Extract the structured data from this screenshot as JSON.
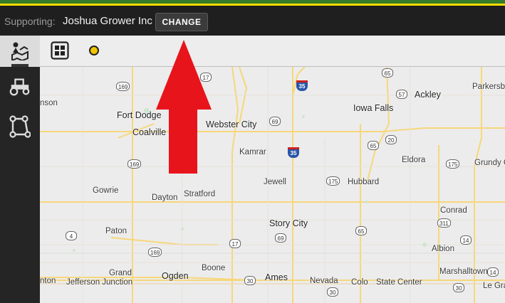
{
  "header": {
    "supporting_label": "Supporting:",
    "organization": "Joshua Grower Inc",
    "change_button": "CHANGE"
  },
  "toolbar": {
    "items": [
      {
        "name": "map-layers",
        "selected": true
      },
      {
        "name": "dashboard-grid",
        "selected": false
      },
      {
        "name": "status-indicator",
        "color": "#f2c400"
      }
    ]
  },
  "sidebar": {
    "icons": [
      "tractor-icon",
      "field-boundary-icon"
    ]
  },
  "map": {
    "places": [
      {
        "text": "nson"
      },
      {
        "text": "Fort Dodge"
      },
      {
        "text": "Coalville"
      },
      {
        "text": "Webster City"
      },
      {
        "text": "Iowa Falls"
      },
      {
        "text": "Ackley"
      },
      {
        "text": "Parkersb"
      },
      {
        "text": "Kamrar"
      },
      {
        "text": "Eldora"
      },
      {
        "text": "Grundy C"
      },
      {
        "text": "Jewell"
      },
      {
        "text": "Hubbard"
      },
      {
        "text": "Gowrie"
      },
      {
        "text": "Dayton"
      },
      {
        "text": "Stratford"
      },
      {
        "text": "Conrad"
      },
      {
        "text": "Paton"
      },
      {
        "text": "Story City"
      },
      {
        "text": "Albion"
      },
      {
        "text": "Boone"
      },
      {
        "text": "Marshalltown"
      },
      {
        "text": "Grand"
      },
      {
        "text": "Ogden"
      },
      {
        "text": "Ames"
      },
      {
        "text": "nton"
      },
      {
        "text": "Jefferson Junction"
      },
      {
        "text": "Nevada"
      },
      {
        "text": "Colo"
      },
      {
        "text": "State Center"
      },
      {
        "text": "Le Gra"
      }
    ],
    "shields": [
      "17",
      "65",
      "57",
      "169",
      "35",
      "69",
      "65",
      "20",
      "169",
      "35",
      "175",
      "175",
      "311",
      "4",
      "169",
      "65",
      "17",
      "69",
      "14",
      "30",
      "30",
      "30",
      "14"
    ]
  },
  "colors": {
    "accent_green": "#367c2b",
    "accent_yellow": "#ffde00",
    "arrow_red": "#e8141c"
  }
}
